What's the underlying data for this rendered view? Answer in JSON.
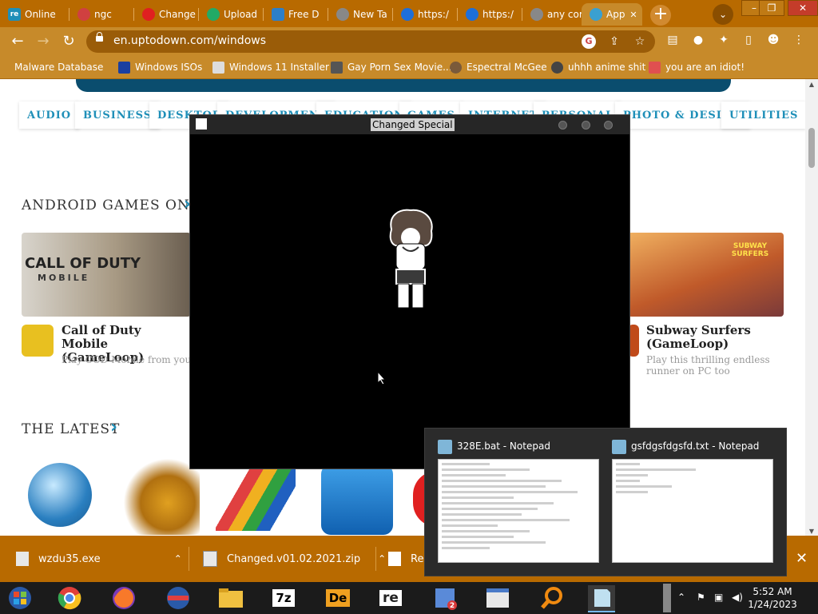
{
  "browser": {
    "tabs": [
      {
        "label": "Online",
        "icon_color": "#1e8fb8",
        "glyph": "re"
      },
      {
        "label": "ngc",
        "icon_color": "#d04040",
        "glyph": ""
      },
      {
        "label": "Change",
        "icon_color": "#e02020",
        "glyph": ""
      },
      {
        "label": "Upload",
        "icon_color": "#22aa66",
        "glyph": ""
      },
      {
        "label": "Free D",
        "icon_color": "#2d7fc9",
        "glyph": ""
      },
      {
        "label": "New Ta",
        "icon_color": "#888888",
        "glyph": ""
      },
      {
        "label": "https:/",
        "icon_color": "#1e6fd9",
        "glyph": ""
      },
      {
        "label": "https:/",
        "icon_color": "#1e6fd9",
        "glyph": ""
      },
      {
        "label": "any cor",
        "icon_color": "#888888",
        "glyph": ""
      },
      {
        "label": "App",
        "icon_color": "#3aa0d0",
        "glyph": ""
      }
    ],
    "url": "en.uptodown.com/windows",
    "bookmarks": [
      {
        "label": "Malware Database",
        "icon_color": "#c78a2a"
      },
      {
        "label": "Windows ISOs",
        "icon_color": "#1a3fa0"
      },
      {
        "label": "Windows 11 Installer",
        "icon_color": "#dddddd"
      },
      {
        "label": "Gay Porn Sex Movie...",
        "icon_color": "#555555"
      },
      {
        "label": "Espectral McGee",
        "icon_color": "#7a5a3a"
      },
      {
        "label": "uhhh anime shit",
        "icon_color": "#444444"
      },
      {
        "label": "you are an idiot!",
        "icon_color": "#e05050"
      }
    ],
    "accent": "#b86a00"
  },
  "page": {
    "categories": [
      "AUDIO",
      "BUSINESS",
      "DESKTOP",
      "DEVELOPMENT",
      "EDUCATION",
      "GAMES",
      "INTERNET",
      "PERSONAL",
      "PHOTO & DESIGN",
      "UTILITIES"
    ],
    "android_title": "ANDROID GAMES ON PC",
    "latest_title": "THE LATEST",
    "cards": [
      {
        "img_text": "CALL OF DUTY",
        "img_sub": "MOBILE",
        "name": "Call of Duty Mobile (GameLoop)",
        "desc": "Play COD Mobile from your PC"
      },
      {
        "img_text": "SUBWAY SURFERS",
        "img_sub": "",
        "name": "Subway Surfers (GameLoop)",
        "desc": "Play this thrilling endless runner on PC too"
      }
    ]
  },
  "game_window": {
    "title": "Changed Special"
  },
  "downloads": [
    {
      "name": "wzdu35.exe"
    },
    {
      "name": "Changed.v01.02.2021.zip"
    },
    {
      "name": "Re"
    }
  ],
  "thumbnails": [
    {
      "title": "328E.bat - Notepad"
    },
    {
      "title": "gsfdgsfdgsfd.txt - Notepad"
    }
  ],
  "taskbar": {
    "apps": [
      "7z",
      "De",
      "re"
    ],
    "time": "5:52 AM",
    "date": "1/24/2023"
  }
}
